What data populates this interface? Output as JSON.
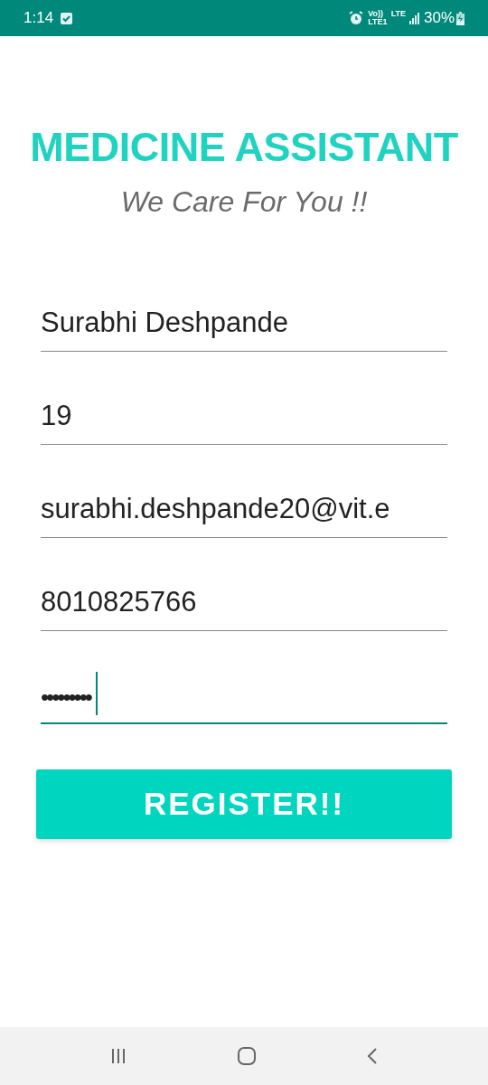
{
  "status_bar": {
    "time": "1:14",
    "volte": "Vo))",
    "lte1": "LTE1",
    "lte": "LTE",
    "battery": "30%"
  },
  "title": "MEDICINE ASSISTANT",
  "subtitle": "We Care For You !!",
  "fields": [
    {
      "kind": "text",
      "value": "Surabhi Deshpande",
      "focused": false
    },
    {
      "kind": "text",
      "value": "19",
      "focused": false
    },
    {
      "kind": "text",
      "value": "surabhi.deshpande20@vit.e",
      "focused": false
    },
    {
      "kind": "text",
      "value": "8010825766",
      "focused": false
    },
    {
      "kind": "password",
      "value": "•••••••••",
      "focused": true
    }
  ],
  "button": "REGISTER!!"
}
